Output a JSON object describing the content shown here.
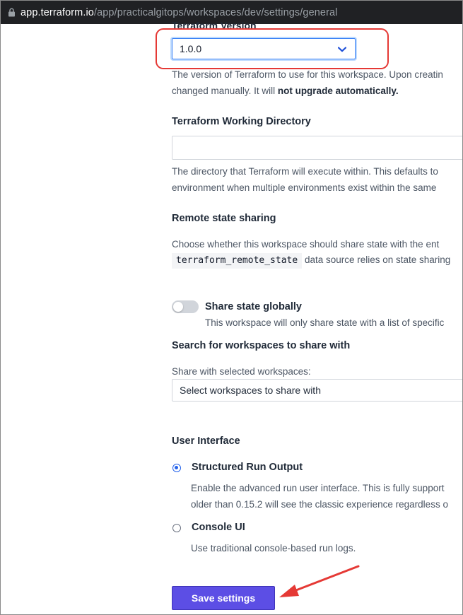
{
  "browser": {
    "url_host": "app.terraform.io",
    "url_path": "/app/practicalgitops/workspaces/dev/settings/general"
  },
  "terraform_version": {
    "label": "Terraform Version",
    "selected": "1.0.0",
    "help_line1": "The version of Terraform to use for this workspace. Upon creatin",
    "help_line2_prefix": "changed manually. It will ",
    "help_line2_bold": "not upgrade automatically."
  },
  "working_directory": {
    "heading": "Terraform Working Directory",
    "value": "",
    "help_line1": "The directory that Terraform will execute within. This defaults to",
    "help_line2": "environment when multiple environments exist within the same"
  },
  "remote_state": {
    "heading": "Remote state sharing",
    "help_line1": "Choose whether this workspace should share state with the ent",
    "code": "terraform_remote_state",
    "help_line2_suffix": " data source relies on state sharing",
    "toggle_label": "Share state globally",
    "toggle_on": false,
    "toggle_help": "This workspace will only share state with a list of specific"
  },
  "workspace_search": {
    "heading": "Search for workspaces to share with",
    "label": "Share with selected workspaces:",
    "placeholder": "Select workspaces to share with"
  },
  "user_interface": {
    "heading": "User Interface",
    "options": [
      {
        "label": "Structured Run Output",
        "checked": true,
        "help_line1": "Enable the advanced run user interface. This is fully support",
        "help_line2": "older than 0.15.2 will see the classic experience regardless o"
      },
      {
        "label": "Console UI",
        "checked": false,
        "help_line1": "Use traditional console-based run logs."
      }
    ]
  },
  "save_button": {
    "label": "Save settings"
  },
  "colors": {
    "accent_purple": "#5c4ee5",
    "focus_blue": "#3b82f6",
    "annotation_red": "#e53935"
  },
  "icons": {
    "lock": "lock-icon",
    "chevron": "chevron-down-icon",
    "annotation": "red-arrow-icon"
  }
}
